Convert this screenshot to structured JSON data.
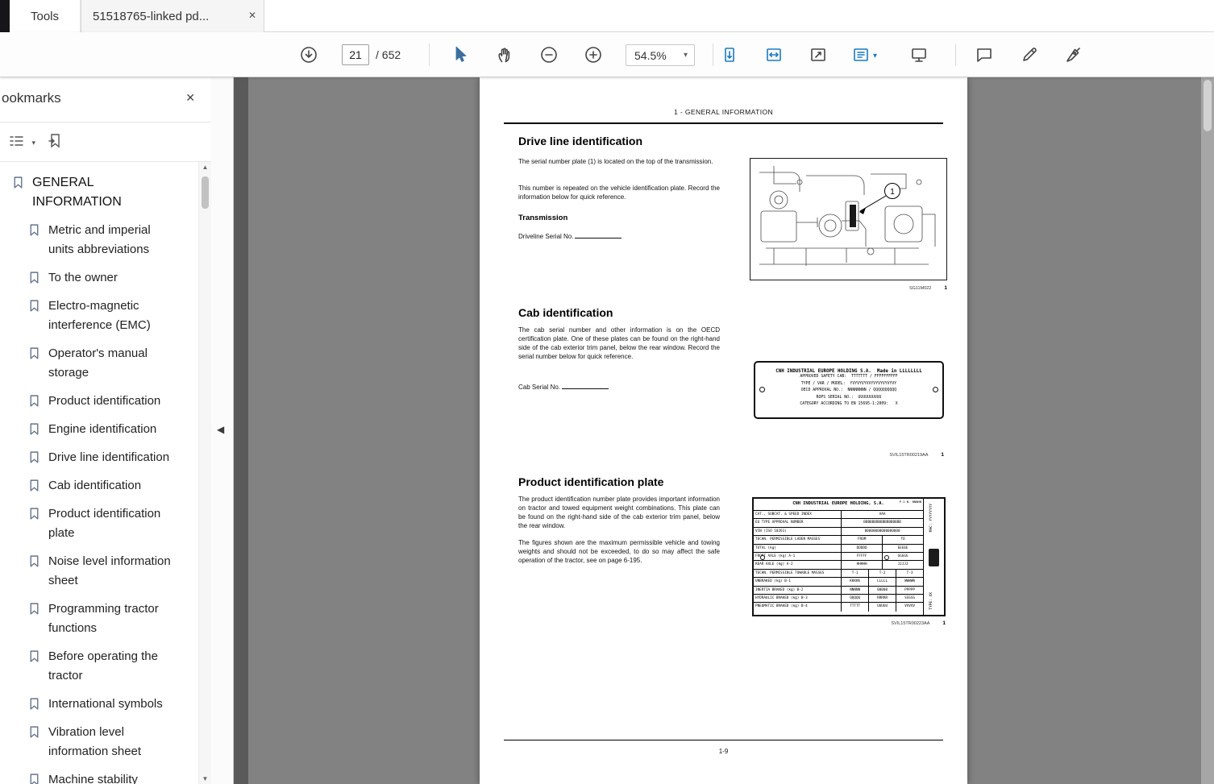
{
  "icons": {
    "tab_close": "✕",
    "panel_close": "✕",
    "caret_down": "▾",
    "collapse_left": "◀",
    "scroll_up": "▲",
    "scroll_down": "▼"
  },
  "window": {
    "tools_tab": "Tools",
    "document_tab": "51518765-linked pd..."
  },
  "toolbar": {
    "page_current": "21",
    "page_total": "/ 652",
    "zoom": "54.5%"
  },
  "bookmarks": {
    "title": "ookmarks",
    "items": [
      {
        "label": "GENERAL INFORMATION"
      },
      {
        "label": "Metric and imperial units abbreviations"
      },
      {
        "label": "To the owner"
      },
      {
        "label": "Electro-magnetic interference (EMC)"
      },
      {
        "label": "Operator's manual storage"
      },
      {
        "label": "Product identification"
      },
      {
        "label": "Engine identification"
      },
      {
        "label": "Drive line identification"
      },
      {
        "label": "Cab identification"
      },
      {
        "label": "Product identification plate"
      },
      {
        "label": "Noise level information sheet"
      },
      {
        "label": "Programming tractor functions"
      },
      {
        "label": "Before operating the tractor"
      },
      {
        "label": "International symbols"
      },
      {
        "label": "Vibration level information sheet"
      },
      {
        "label": "Machine stability"
      }
    ]
  },
  "doc": {
    "running_header": "1 - GENERAL INFORMATION",
    "footer_page": "1-9",
    "drive": {
      "heading": "Drive line identification",
      "para1": "The serial number plate (1) is located on the top of the transmission.",
      "para2": "This number is repeated on the vehicle identification plate. Record the information below for quick reference.",
      "subheading": "Transmission",
      "field_label": "Driveline Serial No.",
      "callout": "1",
      "cap_code": "SG11M022",
      "cap_num": "1"
    },
    "cab": {
      "heading": "Cab identification",
      "para": "The cab serial number and other information is on the OECD certification plate.  One of these plates can be found on the right-hand side of the cab exterior trim panel, below the rear window.  Record the serial number below for quick reference.",
      "field_label": "Cab Serial No.",
      "cap_code": "SVIL15TR00219AA",
      "cap_num": "1",
      "plate_title": "CNH INDUSTRIAL EUROPE HOLDING S.A.  Made in LLLLLLLL",
      "plate_lines": [
        "APPROVED SAFETY CAB:  TTTTTTT / FFFFFFFFFF",
        "TYPE / VAR / MODEL:  YVYVYVYVVYVYVYVYVYVY",
        "OECD APPROVAL NO.:  NNNNNNNN / QQQQQQQQQQ",
        "ROPS SERIAL NO.:  UUUUUUUUUU",
        "CATEGORY ACCORDING TO EN 15695-1:2009:   X"
      ]
    },
    "prod": {
      "heading": "Product identification plate",
      "para1": "The product identification number plate provides important information on tractor and towed equipment weight combinations.  This plate can be found on the right-hand side of the cab exterior trim panel, below the rear window.",
      "para2": "The figures shown are the maximum permissible vehicle and towing weights and should not be exceeded, to do so may affect the safe operation of the tractor, see on page 6-195.",
      "cap_code": "SVIL15TR00223AA",
      "cap_num": "1",
      "plate": {
        "maker": "CNH INDUSTRIAL EUROPE HOLDING, S.A.",
        "pin": "P.I.N. NNNNN",
        "mac": "MAC: YYYYYYYY",
        "type": "TYPE: XX",
        "rows": [
          {
            "label": "CAT., SUBCAT. & SPEED INDEX",
            "v1": "AAA"
          },
          {
            "label": "EU TYPE APPROVAL NUMBER",
            "v1": "BBBBBBBBBBBBBBBBBB"
          },
          {
            "label": "VIN (ISO 10261)",
            "v1": "00000000000000000"
          },
          {
            "label": "TECHN. PERMISSIBLE LADEN MASSES",
            "v1": "FROM",
            "v2": "TO"
          },
          {
            "label": "TOTAL  (kg)",
            "v1": "DDDDD",
            "v2": "EEEEE"
          },
          {
            "label": "FRONT AXLE  (kg)  A-1",
            "v1": "FFFFF",
            "v2": "GGGGG"
          },
          {
            "label": "REAR AXLE  (kg)  A-2",
            "v1": "HHHHH",
            "v2": "JJJJJ"
          },
          {
            "label": "TECHN. PERMISSIBLE TOWABLE MASSES",
            "v1": "T-1",
            "v2": "T-2",
            "v3": "T-3"
          },
          {
            "label": "UNBRAKED  (kg)  B-1",
            "v1": "KKKKK",
            "v2": "LLLLL",
            "v3": "WWWWW"
          },
          {
            "label": "INERTIA BRAKED  (kg)  B-2",
            "v1": "NNNNN",
            "v2": "00000",
            "v3": "PPPPP"
          },
          {
            "label": "HYDRAULIC BRAKED  (kg)  B-3",
            "v1": "QQQQQ",
            "v2": "RRRRR",
            "v3": "SSSSS"
          },
          {
            "label": "PNEUMATIC BRAKED  (kg)  B-4",
            "v1": "TTTTT",
            "v2": "UUUUU",
            "v3": "VVVVV"
          }
        ]
      }
    }
  }
}
